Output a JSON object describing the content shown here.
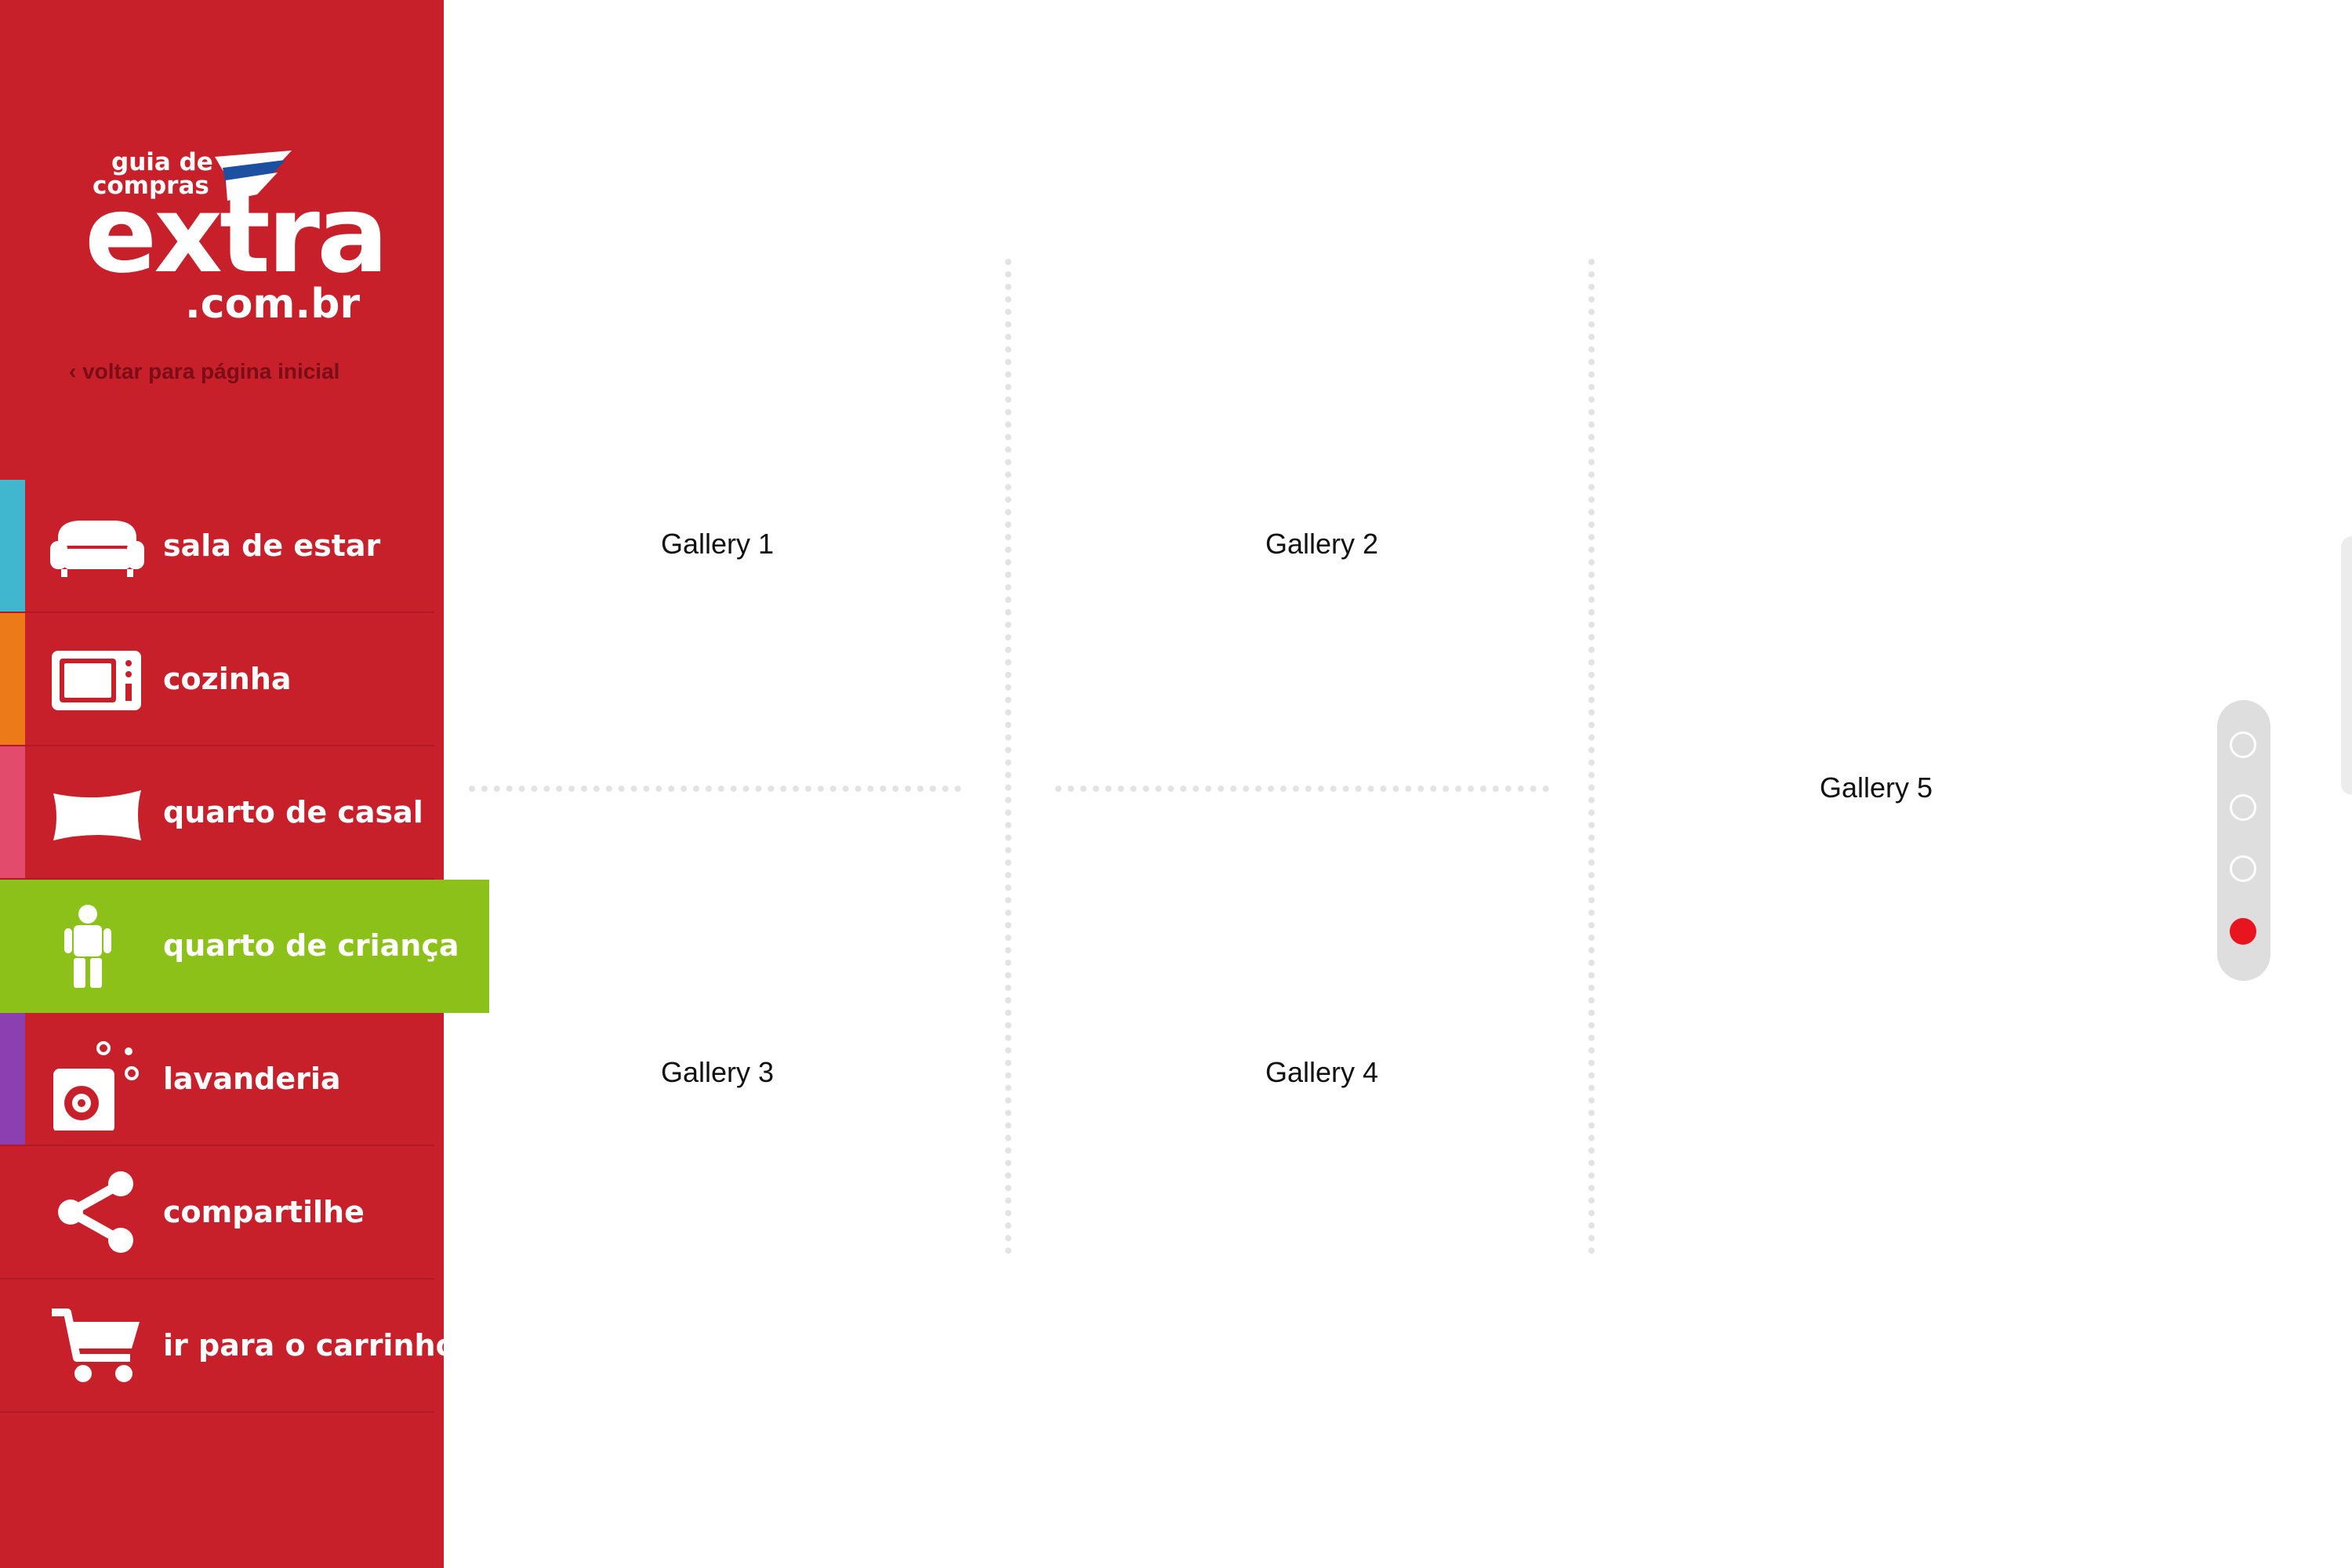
{
  "logo": {
    "line1": "guia de",
    "line2": "compras",
    "main": "extra",
    "domain": ".com.br",
    "back_link": "‹ voltar para página inicial"
  },
  "nav": {
    "items": [
      {
        "label": "sala de estar",
        "icon": "sofa-icon",
        "accent": "#40b7cf",
        "active": false
      },
      {
        "label": "cozinha",
        "icon": "microwave-icon",
        "accent": "#ec7a18",
        "active": false
      },
      {
        "label": "quarto de casal",
        "icon": "pillow-icon",
        "accent": "#e24b6c",
        "active": false
      },
      {
        "label": "quarto de criança",
        "icon": "child-figure-icon",
        "accent": "#8cc11a",
        "active": true
      },
      {
        "label": "lavanderia",
        "icon": "washing-machine-icon",
        "accent": "#8c3fb0",
        "active": false
      },
      {
        "label": "compartilhe",
        "icon": "share-icon",
        "accent": null,
        "active": false
      },
      {
        "label": "ir para o carrinho",
        "icon": "cart-icon",
        "accent": null,
        "active": false
      }
    ]
  },
  "galleries": [
    "Gallery 1",
    "Gallery 2",
    "Gallery 3",
    "Gallery 4",
    "Gallery 5"
  ],
  "pager": {
    "count": 4,
    "active_index": 4
  },
  "colors": {
    "sidebar": "#c8202b",
    "active_item": "#8cc11a",
    "pager_active": "#e8141e"
  }
}
